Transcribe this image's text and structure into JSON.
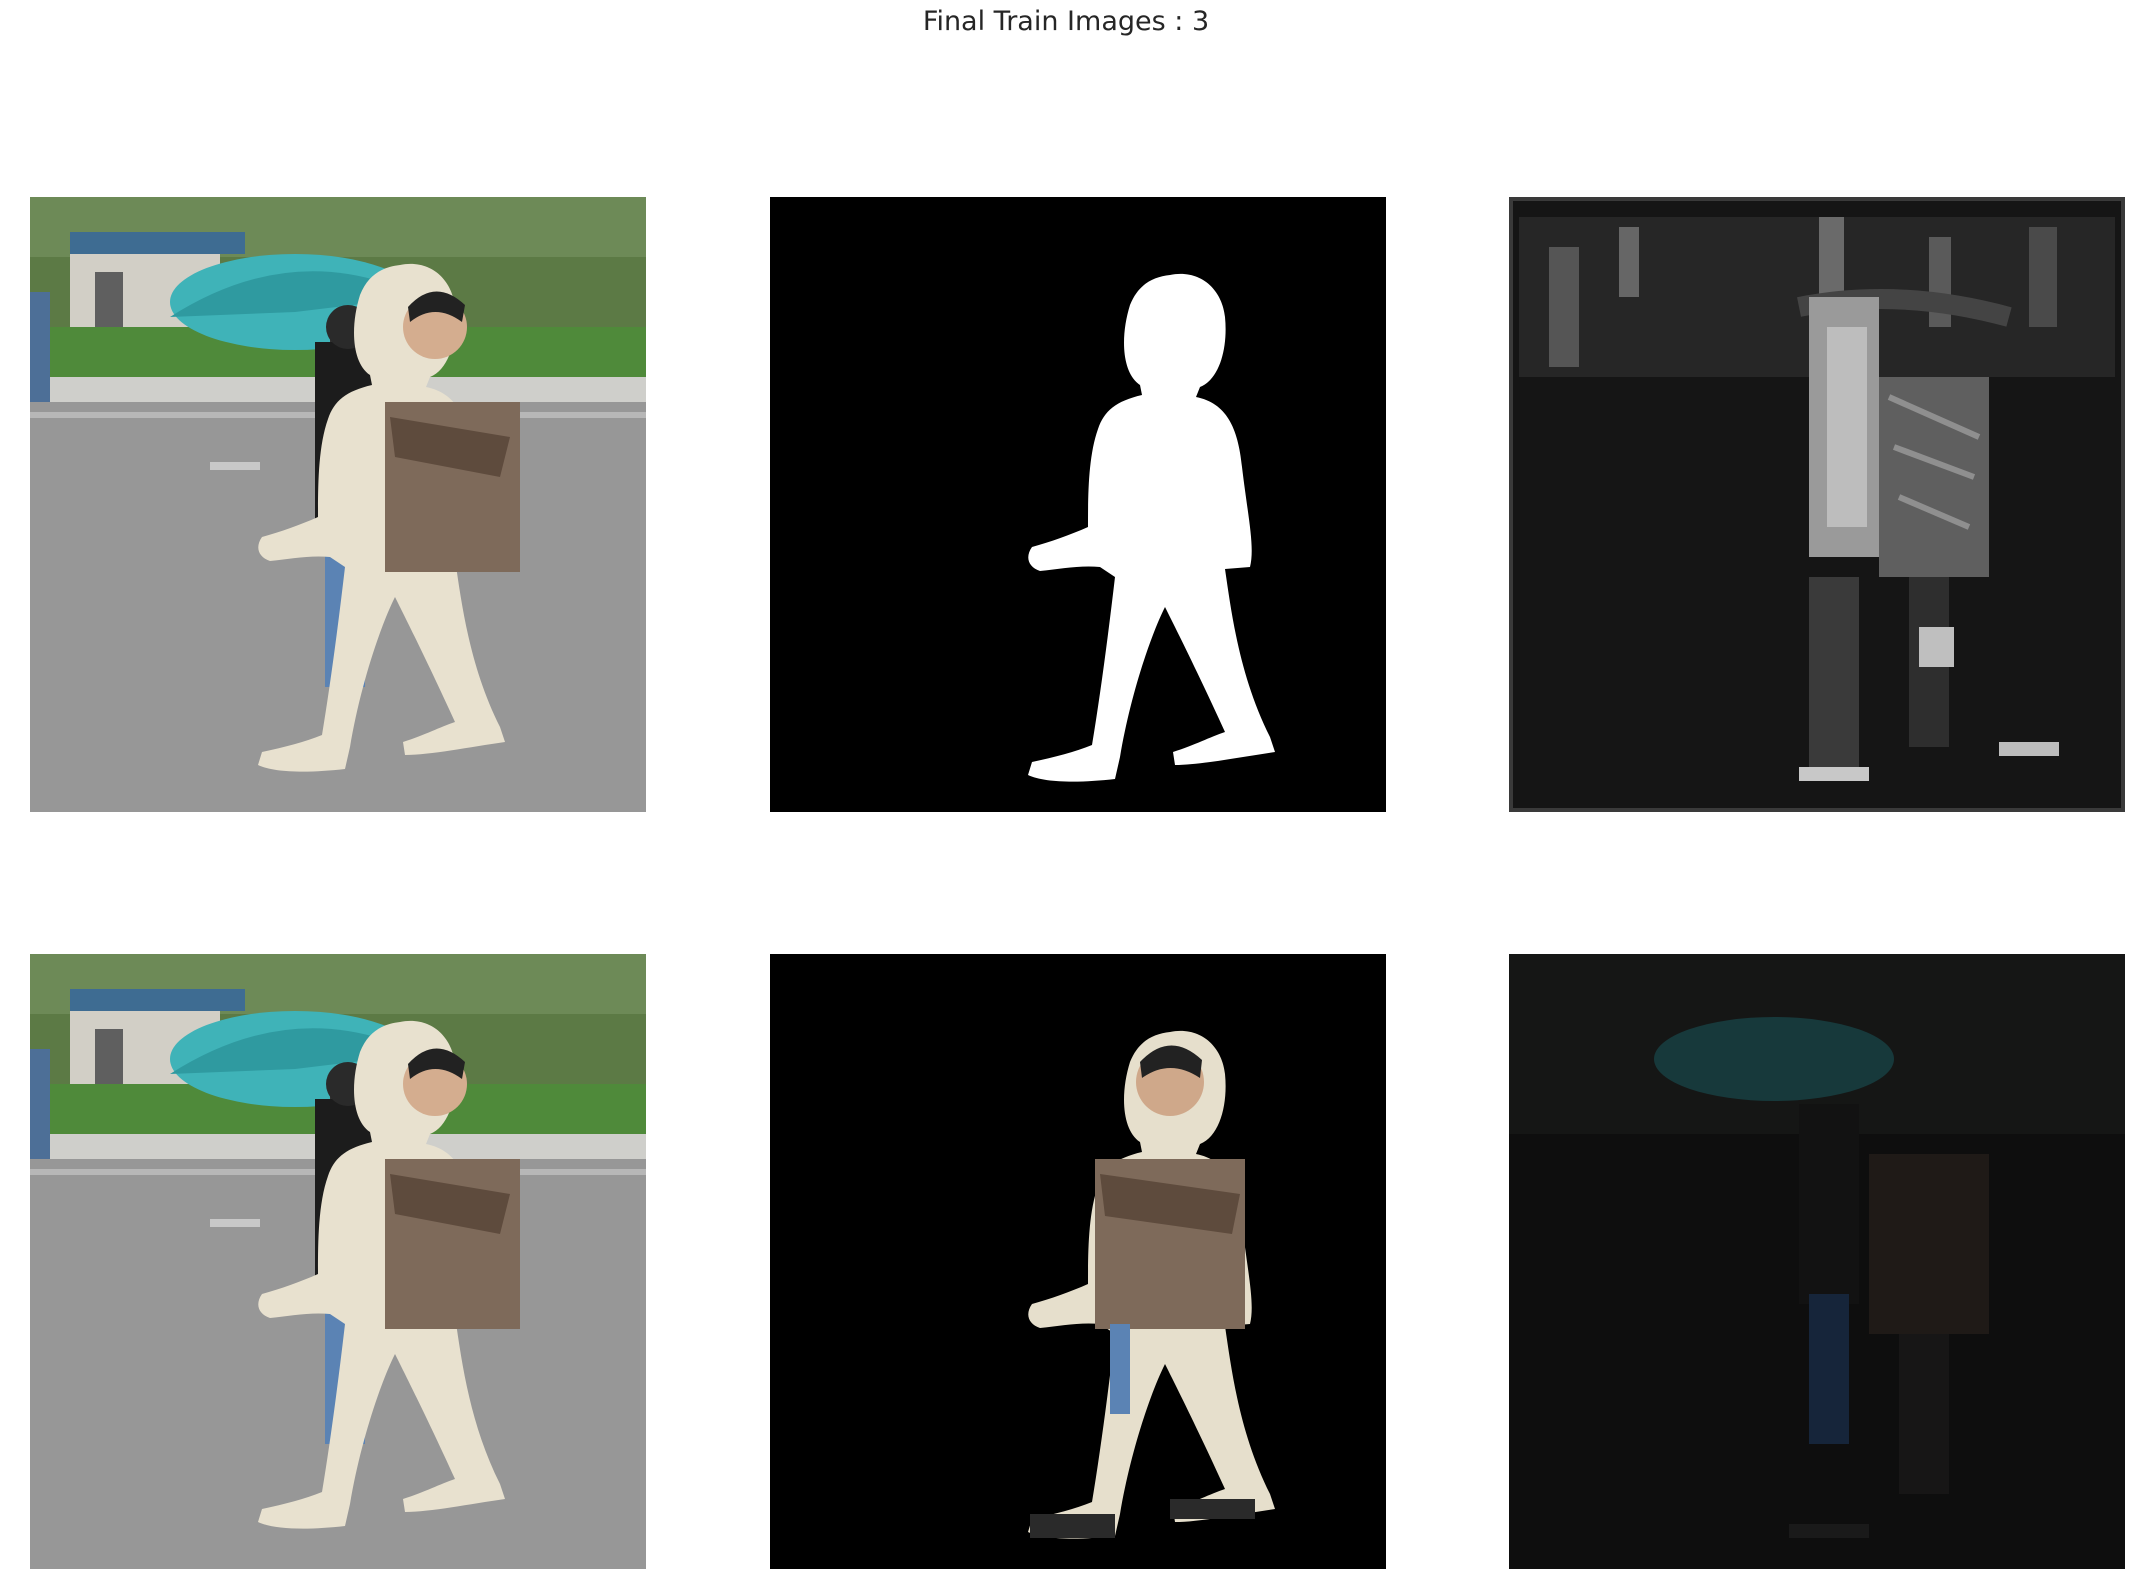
{
  "figure": {
    "title": "Final Train Images : 3"
  },
  "panels": [
    {
      "row": 1,
      "col": 1,
      "content": "original-photo"
    },
    {
      "row": 1,
      "col": 2,
      "content": "binary-mask"
    },
    {
      "row": 1,
      "col": 3,
      "content": "grayscale-activation-map"
    },
    {
      "row": 2,
      "col": 1,
      "content": "original-photo"
    },
    {
      "row": 2,
      "col": 2,
      "content": "masked-photo"
    },
    {
      "row": 2,
      "col": 3,
      "content": "dark-reconstruction"
    }
  ],
  "colors": {
    "umbrella": "#3fb3b8",
    "mask_foreground": "#ffffff",
    "mask_background": "#000000",
    "road": "#9a9a9a",
    "trees": "#4a7a35"
  }
}
